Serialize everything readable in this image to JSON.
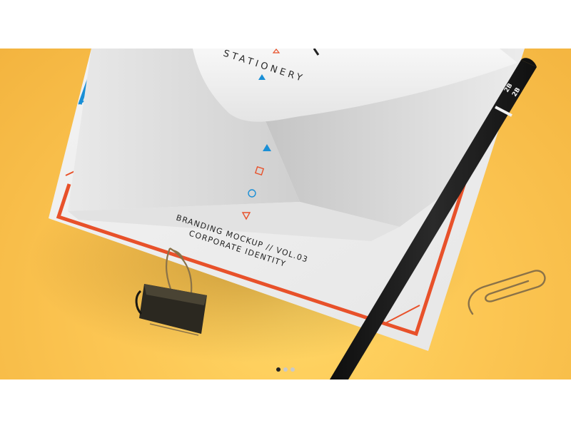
{
  "slider": {
    "current_slide": 1,
    "slide_count": 3
  },
  "mockup": {
    "flap_title": "STATIONERY",
    "caption_line1": "BRANDING MOCKUP // VOL.03",
    "caption_line2": "CORPORATE IDENTITY",
    "pencil_grade_1": "2B",
    "pencil_grade_2": "2B"
  },
  "colors": {
    "background": "#fcc653",
    "accent_orange": "#e8512a",
    "accent_blue": "#1a8fd6",
    "pencil": "#1c1c1c",
    "clip_metal": "#8a7248",
    "active_dot": "#222222",
    "inactive_dot": "#c9c9c9"
  }
}
